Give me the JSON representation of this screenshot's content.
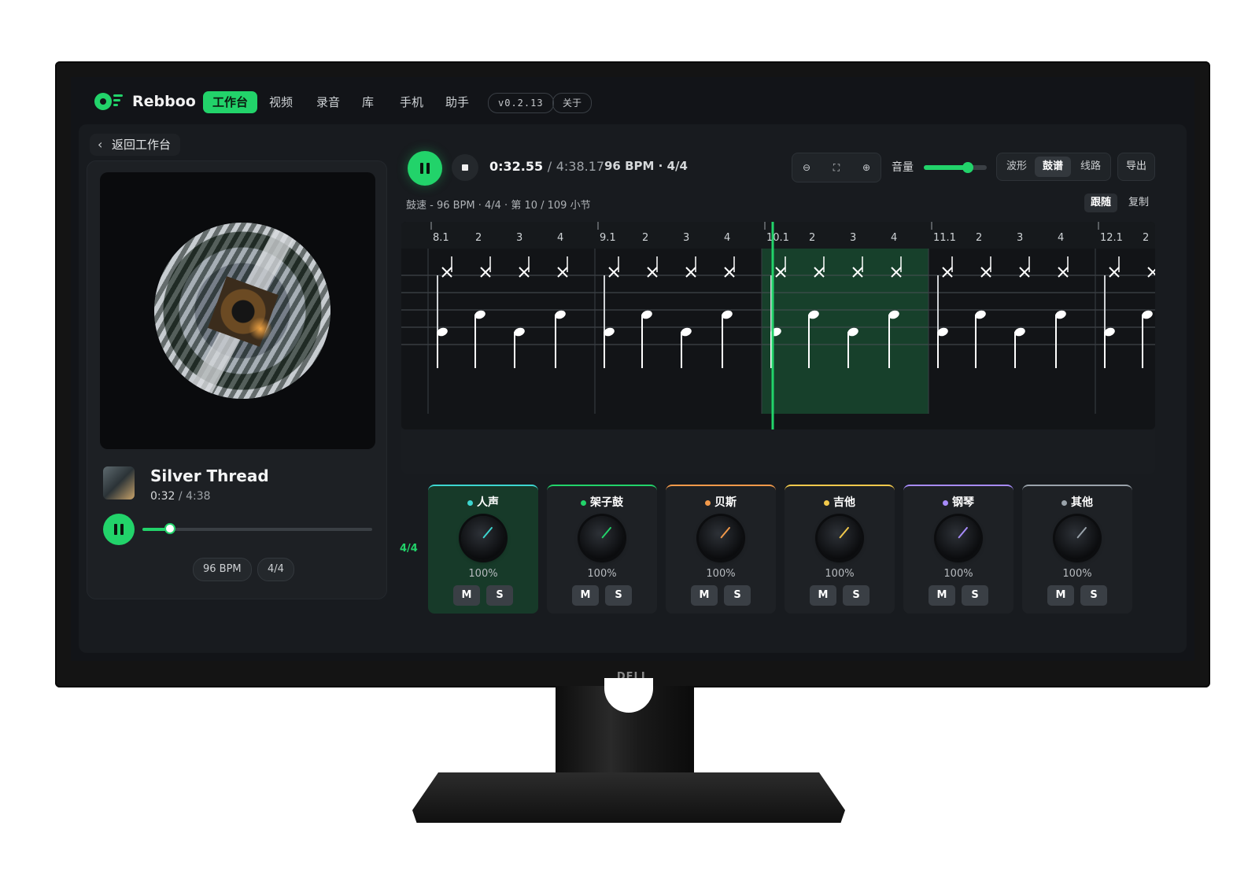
{
  "nav": {
    "app_name": "Rebboo",
    "items": [
      "工作台",
      "视频",
      "录音",
      "库",
      "手机",
      "助手"
    ],
    "version": "v0.2.13",
    "about": "关于"
  },
  "back_label": "返回工作台",
  "player": {
    "title": "Silver Thread",
    "time_current": "0:32",
    "time_sep": "/",
    "time_total": "4:38",
    "progress": 0.12,
    "bpm_chip": "96 BPM",
    "meter_chip": "4/4"
  },
  "transport": {
    "time_current": "0:32.55",
    "time_sep": "/",
    "time_total": "4:38.17",
    "bpm_meter": "96 BPM · 4/4",
    "volume_label": "音量",
    "volume_level": 0.7,
    "views": [
      "波形",
      "鼓谱",
      "线路"
    ],
    "active_view": "鼓谱",
    "export": "导出",
    "info": "鼓速 - 96 BPM · 4/4 · 第 10 / 109 小节",
    "follow": "跟随",
    "copy": "复制"
  },
  "score": {
    "measures": [
      8,
      9,
      10,
      11,
      12
    ],
    "active_measure": 10,
    "beat_labels": [
      "2",
      "3",
      "4"
    ],
    "time_signature": "4/4"
  },
  "mixer": [
    {
      "name": "人声",
      "volume": "100%",
      "color": "#3dd6d0",
      "active": true
    },
    {
      "name": "架子鼓",
      "volume": "100%",
      "color": "#22d36a",
      "active": false
    },
    {
      "name": "贝斯",
      "volume": "100%",
      "color": "#f2994a",
      "active": false
    },
    {
      "name": "吉他",
      "volume": "100%",
      "color": "#f2c94c",
      "active": false
    },
    {
      "name": "钢琴",
      "volume": "100%",
      "color": "#a78bfa",
      "active": false
    },
    {
      "name": "其他",
      "volume": "100%",
      "color": "#9aa3ab",
      "active": false
    }
  ],
  "mute_label": "M",
  "solo_label": "S",
  "bezel_logo": "DELL",
  "colors": {
    "accent": "#22d36a",
    "background": "#121418"
  }
}
